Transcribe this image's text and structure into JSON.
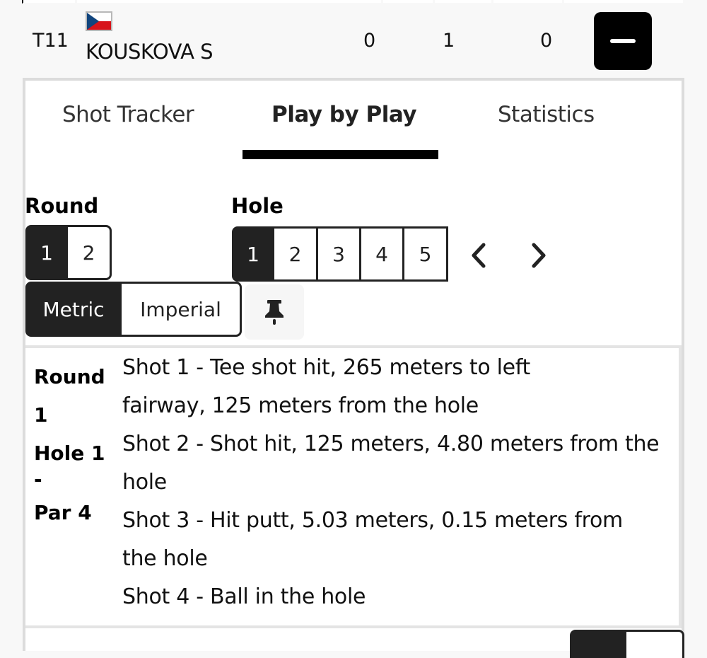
{
  "player": {
    "position": "T11",
    "country": "Czech Republic",
    "flag_icon": "czech-flag-icon",
    "name": "KOUSKOVA S",
    "scores": [
      "0",
      "1",
      "0"
    ],
    "collapse_icon": "minus-icon"
  },
  "tabs": [
    {
      "label": "Shot Tracker",
      "active": false
    },
    {
      "label": "Play by Play",
      "active": true
    },
    {
      "label": "Statistics",
      "active": false
    }
  ],
  "round": {
    "label": "Round",
    "options": [
      "1",
      "2"
    ],
    "selected": "1"
  },
  "hole": {
    "label": "Hole",
    "options": [
      "1",
      "2",
      "3",
      "4",
      "5"
    ],
    "selected": "1",
    "prev_icon": "chevron-left-icon",
    "next_icon": "chevron-right-icon"
  },
  "units": {
    "options": [
      "Metric",
      "Imperial"
    ],
    "selected": "Metric",
    "pin_icon": "pushpin-icon"
  },
  "play_by_play": {
    "header_lines": [
      "Round",
      "1",
      "Hole 1",
      "-",
      "Par 4"
    ],
    "shots": [
      "Shot 1 - Tee shot hit, 265 meters to left fairway, 125 meters from the hole",
      "Shot 2 - Shot hit, 125 meters, 4.80 meters from the hole",
      "Shot 3 - Hit putt, 5.03 meters, 0.15 meters from the hole",
      "Shot 4 - Ball in the hole"
    ]
  },
  "colors": {
    "active": "#222222",
    "flag_blue": "#11457e",
    "flag_red": "#d7141a",
    "flag_white": "#ffffff"
  }
}
